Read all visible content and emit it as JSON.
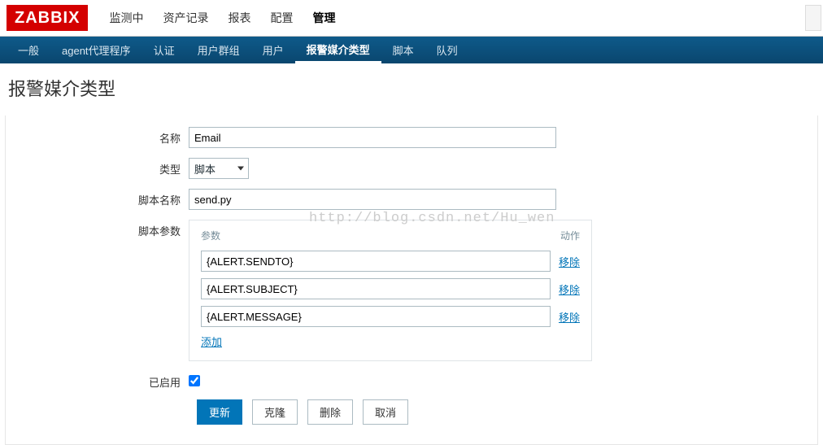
{
  "logo": "ZABBIX",
  "topnav": {
    "items": [
      "监测中",
      "资产记录",
      "报表",
      "配置",
      "管理"
    ],
    "active": 4
  },
  "subnav": {
    "items": [
      "一般",
      "agent代理程序",
      "认证",
      "用户群组",
      "用户",
      "报警媒介类型",
      "脚本",
      "队列"
    ],
    "active": 5
  },
  "page_title": "报警媒介类型",
  "form": {
    "name_label": "名称",
    "name_value": "Email",
    "type_label": "类型",
    "type_value": "脚本",
    "script_name_label": "脚本名称",
    "script_name_value": "send.py",
    "script_params_label": "脚本参数",
    "params_header_left": "参数",
    "params_header_right": "动作",
    "params": [
      {
        "value": "{ALERT.SENDTO}",
        "action": "移除"
      },
      {
        "value": "{ALERT.SUBJECT}",
        "action": "移除"
      },
      {
        "value": "{ALERT.MESSAGE}",
        "action": "移除"
      }
    ],
    "add_label": "添加",
    "enabled_label": "已启用",
    "enabled_checked": true
  },
  "buttons": {
    "update": "更新",
    "clone": "克隆",
    "delete": "删除",
    "cancel": "取消"
  },
  "watermark": "http://blog.csdn.net/Hu_wen"
}
